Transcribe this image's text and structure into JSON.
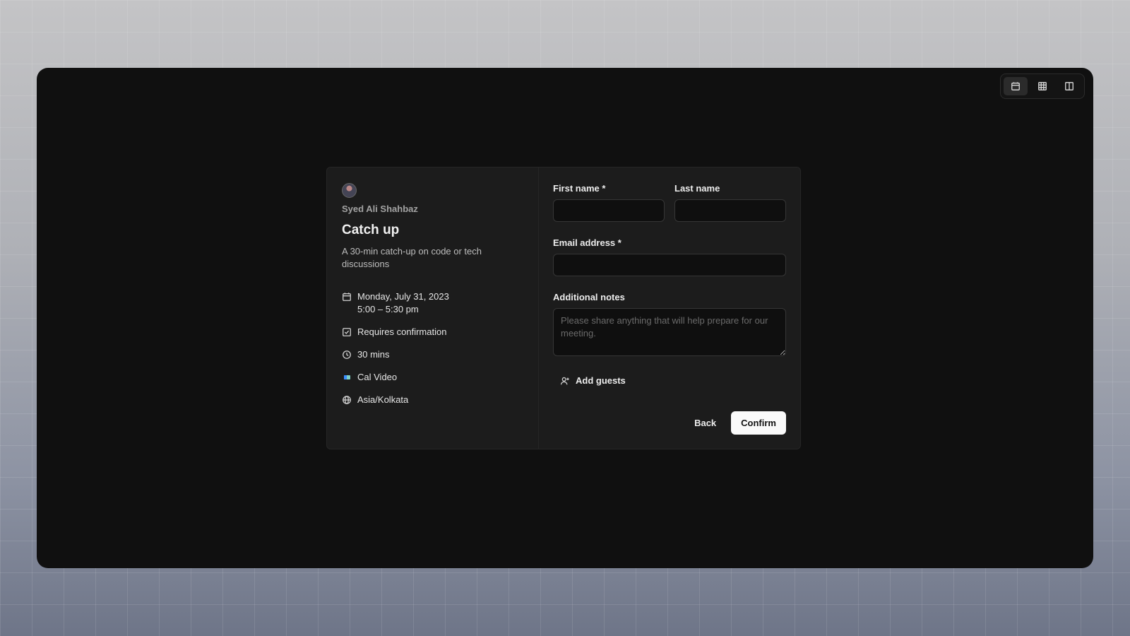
{
  "view_toggle": {
    "icons": [
      "calendar-icon",
      "grid-icon",
      "columns-icon"
    ],
    "active_index": 0
  },
  "event": {
    "host_name": "Syed Ali Shahbaz",
    "title": "Catch up",
    "description": "A 30-min catch-up on code or tech discussions",
    "date": "Monday, July 31, 2023",
    "time": "5:00 – 5:30 pm",
    "confirmation": "Requires confirmation",
    "duration": "30 mins",
    "location": "Cal Video",
    "timezone": "Asia/Kolkata"
  },
  "form": {
    "first_name_label": "First name *",
    "last_name_label": "Last name",
    "email_label": "Email address *",
    "notes_label": "Additional notes",
    "notes_placeholder": "Please share anything that will help prepare for our meeting.",
    "first_name_value": "",
    "last_name_value": "",
    "email_value": "",
    "add_guests_label": "Add guests"
  },
  "actions": {
    "back_label": "Back",
    "confirm_label": "Confirm"
  },
  "colors": {
    "window_bg": "#101010",
    "card_bg": "#1c1c1c",
    "confirm_bg": "#fafafa"
  }
}
